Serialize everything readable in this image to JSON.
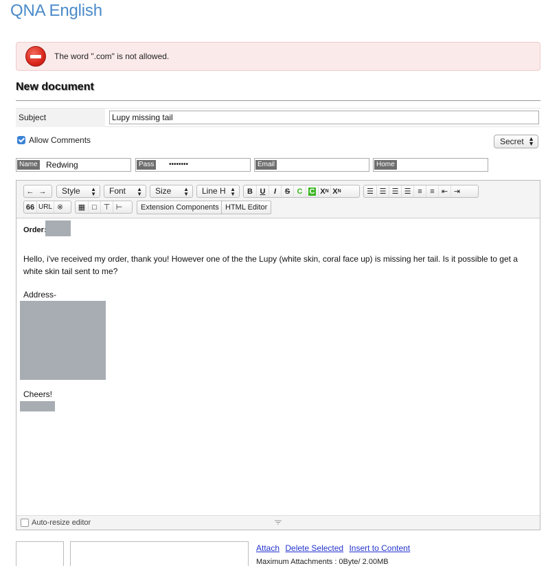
{
  "site": {
    "title": "QNA English"
  },
  "alert": {
    "message": "The word \".com\" is not allowed."
  },
  "document": {
    "heading": "New document"
  },
  "subject": {
    "label": "Subject",
    "value": "Lupy missing tail"
  },
  "options": {
    "allow_comments_label": "Allow Comments",
    "allow_comments_checked": true,
    "secret_label": "Secret"
  },
  "credentials": {
    "name_tag": "Name",
    "name_value": "Redwing",
    "pass_tag": "Pass",
    "pass_value": "••••••••",
    "email_tag": "Email",
    "email_value": "",
    "home_tag": "Home",
    "home_value": ""
  },
  "toolbar": {
    "style": "Style",
    "font": "Font",
    "size": "Size",
    "line_height": "Line H",
    "bold": "B",
    "underline": "U",
    "italic": "I",
    "strike": "S",
    "font_color": "C",
    "bg_color": "C",
    "superscript": "X",
    "subscript": "X",
    "url": "URL",
    "quote": "66",
    "special": "※",
    "extension_components": "Extension Components",
    "html_editor": "HTML Editor"
  },
  "content": {
    "order_label": "Order:",
    "paragraph": "Hello, i've received my order, thank you! However one of the the Lupy (white skin, coral face up) is missing her tail. Is it possible to get a white skin tail sent to me?",
    "address_label": "Address-",
    "closing": "Cheers!"
  },
  "editor_footer": {
    "autoresize_label": "Auto-resize editor"
  },
  "attachments": {
    "attach": "Attach",
    "delete_selected": "Delete Selected",
    "insert_to_content": "Insert to Content",
    "max_label": "Maximum Attachments : 0Byte/ 2.00MB"
  }
}
